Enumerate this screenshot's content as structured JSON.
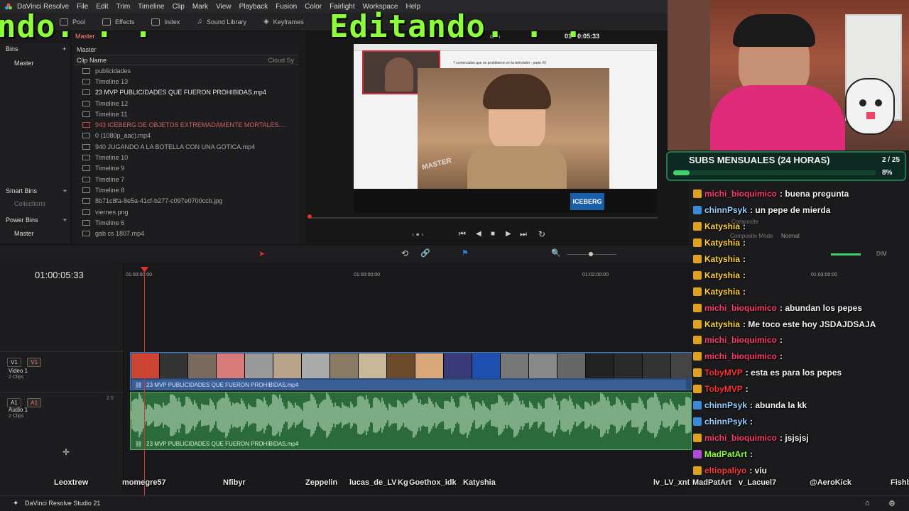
{
  "app": {
    "title": "DaVinci Resolve",
    "menus": [
      "File",
      "Edit",
      "Trim",
      "Timeline",
      "Clip",
      "Mark",
      "View",
      "Playback",
      "Fusion",
      "Color",
      "Fairlight",
      "Workspace",
      "Help"
    ]
  },
  "toolbar": {
    "media_pool": "Pool",
    "effects": "Effects",
    "index": "Index",
    "sound_library": "Sound Library",
    "keyframes": "Keyframes",
    "master_label": "Master"
  },
  "overlay": {
    "left_text": "ndo. . .",
    "center_text": "Editando. . ."
  },
  "bins": {
    "header": "Bins",
    "items": [
      "Master"
    ],
    "smart_bins": "Smart Bins",
    "collections": "Collections",
    "power_bins": "Power Bins",
    "power_master": "Master"
  },
  "clips": {
    "path": "Master",
    "col_name": "Clip Name",
    "col_cloud": "Cloud Sy",
    "rows": [
      "publicidades",
      "Timeline 13",
      "23 MVP PUBLICIDADES QUE FUERON PROHIBIDAS.mp4",
      "Timeline 12",
      "Timeline 11",
      "943 ICEBERG DE OBJETOS EXTREMADAMENTE MORTALES....",
      "0 (1080p_aac).mp4",
      "940 JUGANDO A LA BOTELLA CON UNA GOTICA.mp4",
      "Timeline 10",
      "Timeline 9",
      "Timeline 7",
      "Timeline 8",
      "8b71c8fa-8e5a-41cf-b277-c097e0700ccb.jpg",
      "viernes.png",
      "Timeline 6",
      "gab cs 1807.mp4"
    ]
  },
  "viewer": {
    "timecode": "01:00:05:33",
    "tag": "dris",
    "video_title": "7 comerciales que se prohibieron en la televisión - parte #2",
    "stamp": "MASTER"
  },
  "subs": {
    "title": "SUBS MENSUALES (24 HORAS)",
    "count": "2 / 25",
    "percent": "8%",
    "progress": 0.08
  },
  "timeline": {
    "timecode": "01:00:05:33",
    "ruler": [
      "01:00:00:00",
      "01:00:00:00",
      "01:02:00:00",
      "01:03:00:00"
    ],
    "video_track": {
      "id": "V1",
      "name": "Video 1",
      "clips": "2 Clips"
    },
    "audio_track": {
      "id": "A1",
      "name": "Audio 1",
      "clips": "2 Clips",
      "level": "2.0"
    },
    "clip_name": "23 MVP PUBLICIDADES QUE FUERON PROHIBIDAS.mp4",
    "composite": "Composite",
    "composite_mode": "Composite Mode",
    "normal": "Normal",
    "dim": "DIM"
  },
  "chat": [
    {
      "user": "michi_bioquimico",
      "color": "#ff3b6b",
      "msg": ": buena pregunta"
    },
    {
      "user": "chinnPsyk",
      "color": "#9ad0ff",
      "msg": ": un pepe de mierda"
    },
    {
      "user": "Katyshia",
      "color": "#ffd23b",
      "msg": ":"
    },
    {
      "user": "Katyshia",
      "color": "#ffd23b",
      "msg": ":"
    },
    {
      "user": "Katyshia",
      "color": "#ffd23b",
      "msg": ":"
    },
    {
      "user": "Katyshia",
      "color": "#ffd23b",
      "msg": ":"
    },
    {
      "user": "Katyshia",
      "color": "#ffd23b",
      "msg": ":"
    },
    {
      "user": "michi_bioquimico",
      "color": "#ff3b6b",
      "msg": ": abundan los pepes"
    },
    {
      "user": "Katyshia",
      "color": "#ffd23b",
      "msg": ": Me toco este hoy JSDAJDSAJA"
    },
    {
      "user": "michi_bioquimico",
      "color": "#ff3b6b",
      "msg": ":"
    },
    {
      "user": "michi_bioquimico",
      "color": "#ff3b6b",
      "msg": ":"
    },
    {
      "user": "TobyMVP",
      "color": "#ff3030",
      "msg": ": esta es para los pepes"
    },
    {
      "user": "TobyMVP",
      "color": "#ff3030",
      "msg": ":"
    },
    {
      "user": "chinnPsyk",
      "color": "#9ad0ff",
      "msg": ": abunda la kk"
    },
    {
      "user": "chinnPsyk",
      "color": "#9ad0ff",
      "msg": ":"
    },
    {
      "user": "michi_bioquimico",
      "color": "#ff3b6b",
      "msg": ": jsjsjsj"
    },
    {
      "user": "MadPatArt",
      "color": "#8dff3a",
      "msg": ":"
    },
    {
      "user": "eltiopaliyo",
      "color": "#ff3b3b",
      "msg": ": viu"
    }
  ],
  "bottom_names": [
    "Leoxtrew",
    "momegre57",
    "Nfibyr",
    "Zeppelin",
    "lucas_de_LV",
    "Kg",
    "Goethox_idk",
    "Katyshia",
    "lv_LV_xnt",
    "MadPatArt",
    "v_Lacuel7",
    "@AeroKick",
    "Fishb"
  ],
  "dock": {
    "app": "DaVinci Resolve Studio 21"
  }
}
